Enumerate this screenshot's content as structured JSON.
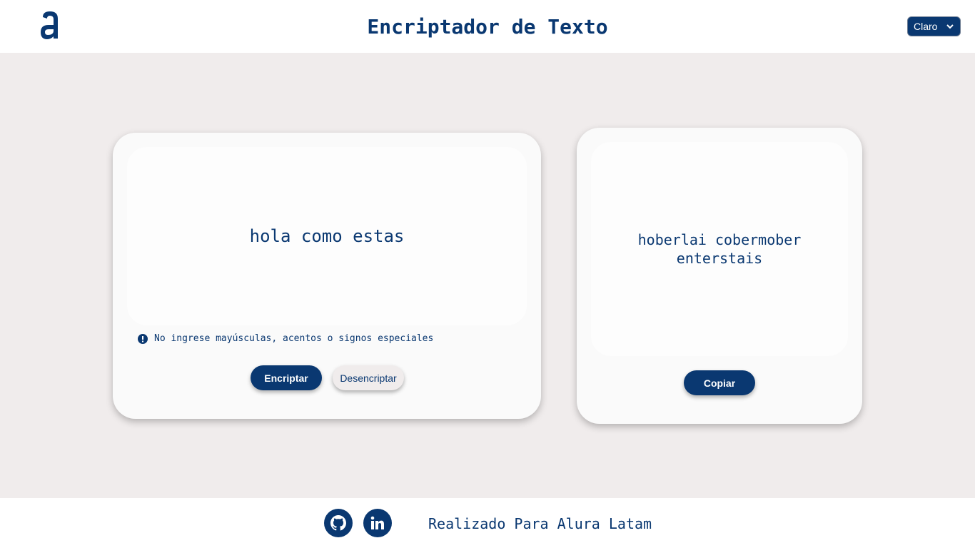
{
  "header": {
    "title": "Encriptador de Texto",
    "logo_icon": "alura-logo-icon",
    "theme_select": {
      "selected": "Claro"
    }
  },
  "input_panel": {
    "text": "hola como estas",
    "warning_icon": "exclamation-circle-icon",
    "warning": "No ingrese mayúsculas, acentos o signos especiales",
    "encrypt_label": "Encriptar",
    "decrypt_label": "Desencriptar"
  },
  "output_panel": {
    "text": "hoberlai cobermober enterstais",
    "copy_label": "Copiar"
  },
  "footer": {
    "github_icon": "github-icon",
    "linkedin_icon": "linkedin-icon",
    "text": "Realizado Para Alura Latam"
  },
  "colors": {
    "primary": "#0a3871",
    "background": "#f0ecec",
    "card": "#fafafa",
    "header": "#ffffff"
  }
}
